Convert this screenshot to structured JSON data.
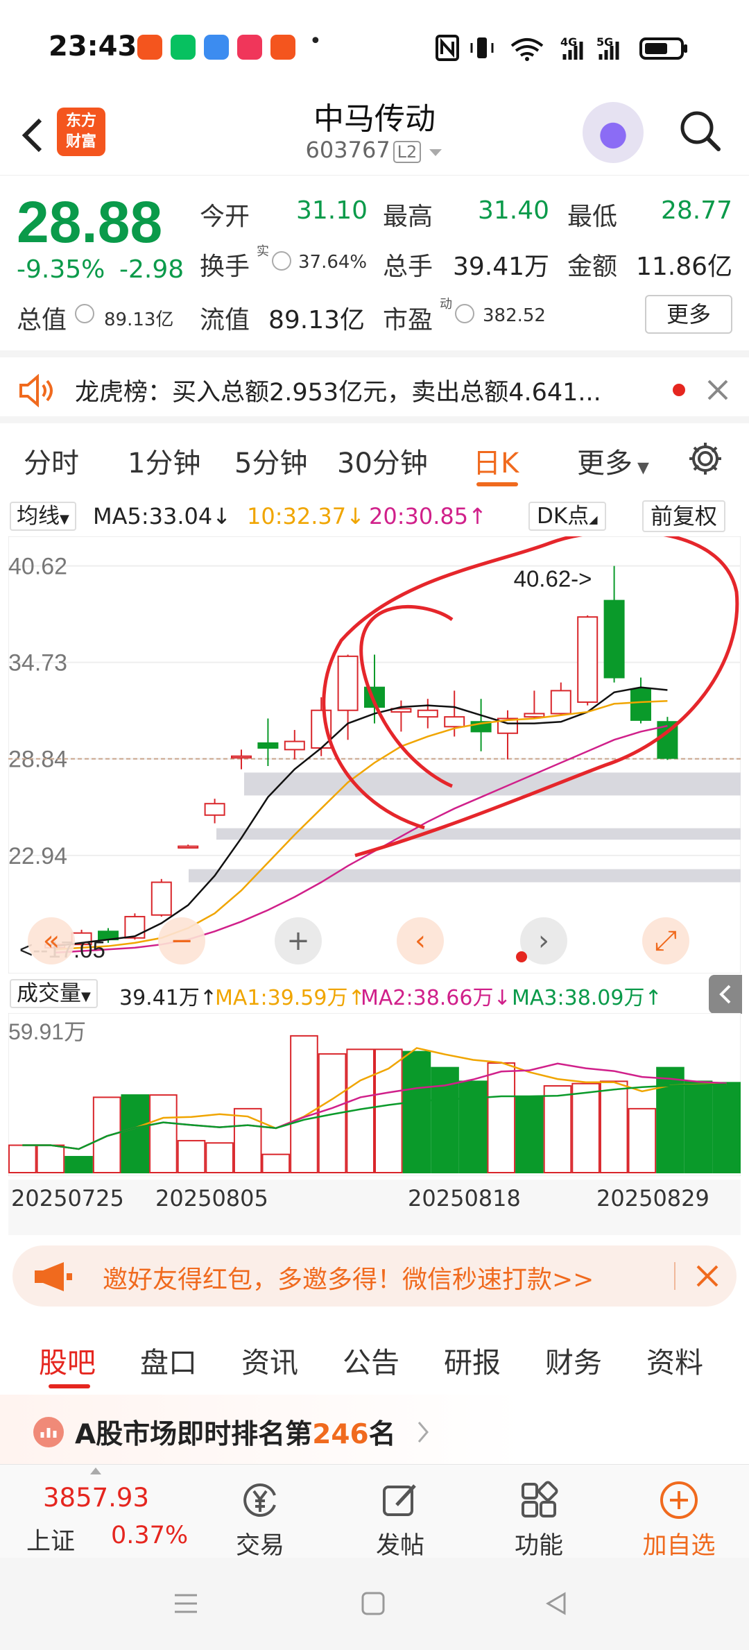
{
  "status_bar": {
    "time": "23:43",
    "dot": "•"
  },
  "header": {
    "back_icon": "chevron-left-icon",
    "logo_line1": "东方",
    "logo_line2": "财富",
    "title": "中马传动",
    "code": "603767",
    "level": "L2"
  },
  "quote": {
    "price": "28.88",
    "change_pct": "-9.35%",
    "change_abs": "-2.98",
    "open_label": "今开",
    "open": "31.10",
    "high_label": "最高",
    "high": "31.40",
    "low_label": "最低",
    "low": "28.77",
    "turnover_label": "换手",
    "turnover_sup": "实",
    "turnover": "37.64%",
    "volume_label": "总手",
    "volume": "39.41万",
    "amount_label": "金额",
    "amount": "11.86亿",
    "mktcap_label": "总值",
    "mktcap": "89.13亿",
    "float_label": "流值",
    "float": "89.13亿",
    "pe_label": "市盈",
    "pe_sup": "动",
    "pe": "382.52",
    "more": "更多"
  },
  "dragon_tiger": {
    "text": "龙虎榜：买入总额2.953亿元，卖出总额4.641..."
  },
  "chart_tabs": [
    "分时",
    "1分钟",
    "5分钟",
    "30分钟",
    "日K",
    "更多"
  ],
  "active_tab": "日K",
  "ma_bar": {
    "button": "均线",
    "ma5": "MA5:33.04↓",
    "ma10": "10:32.37↓",
    "ma20": "20:30.85↑",
    "dk": "DK点",
    "adjust": "前复权"
  },
  "volume_bar": {
    "button": "成交量",
    "vol": "39.41万↑",
    "ma1": "MA1:39.59万↑",
    "ma2": "MA2:38.66万↓",
    "ma3": "MA3:38.09万↑"
  },
  "chart_data": [
    {
      "type": "candlestick",
      "title": "",
      "y_ticks": [
        "40.62",
        "34.73",
        "28.84",
        "22.94"
      ],
      "ylim": [
        17.0,
        42.0
      ],
      "current_price_line": 28.84,
      "annotations": [
        "40.62->",
        "<--17.05"
      ],
      "candles": [
        {
          "o": 17.3,
          "c": 17.5,
          "h": 17.6,
          "l": 17.05,
          "color": "red"
        },
        {
          "o": 17.5,
          "c": 18.2,
          "h": 18.4,
          "l": 17.3,
          "color": "red"
        },
        {
          "o": 18.3,
          "c": 17.8,
          "h": 18.5,
          "l": 17.6,
          "color": "green"
        },
        {
          "o": 17.9,
          "c": 19.2,
          "h": 19.4,
          "l": 17.8,
          "color": "red"
        },
        {
          "o": 19.3,
          "c": 21.3,
          "h": 21.5,
          "l": 19.2,
          "color": "red"
        },
        {
          "o": 23.4,
          "c": 23.5,
          "h": 23.6,
          "l": 23.4,
          "color": "red"
        },
        {
          "o": 25.4,
          "c": 26.1,
          "h": 26.4,
          "l": 24.9,
          "color": "red"
        },
        {
          "o": 28.9,
          "c": 29.0,
          "h": 29.4,
          "l": 28.2,
          "color": "red"
        },
        {
          "o": 29.8,
          "c": 29.5,
          "h": 31.3,
          "l": 28.4,
          "color": "green"
        },
        {
          "o": 29.4,
          "c": 29.9,
          "h": 30.6,
          "l": 28.8,
          "color": "red"
        },
        {
          "o": 29.5,
          "c": 31.8,
          "h": 32.6,
          "l": 29.0,
          "color": "red"
        },
        {
          "o": 31.8,
          "c": 35.1,
          "h": 35.2,
          "l": 30.0,
          "color": "red"
        },
        {
          "o": 33.2,
          "c": 32.0,
          "h": 35.2,
          "l": 31.0,
          "color": "green"
        },
        {
          "o": 31.7,
          "c": 31.9,
          "h": 32.4,
          "l": 30.5,
          "color": "red"
        },
        {
          "o": 31.4,
          "c": 31.8,
          "h": 32.5,
          "l": 30.7,
          "color": "red"
        },
        {
          "o": 30.8,
          "c": 31.4,
          "h": 33.0,
          "l": 30.2,
          "color": "red"
        },
        {
          "o": 31.1,
          "c": 30.5,
          "h": 32.5,
          "l": 29.3,
          "color": "green"
        },
        {
          "o": 30.4,
          "c": 31.3,
          "h": 31.8,
          "l": 28.8,
          "color": "red"
        },
        {
          "o": 31.4,
          "c": 31.6,
          "h": 33.0,
          "l": 31.3,
          "color": "red"
        },
        {
          "o": 31.6,
          "c": 33.0,
          "h": 33.5,
          "l": 31.5,
          "color": "red"
        },
        {
          "o": 32.3,
          "c": 37.5,
          "h": 37.6,
          "l": 32.1,
          "color": "red"
        },
        {
          "o": 38.5,
          "c": 33.8,
          "h": 40.62,
          "l": 33.5,
          "color": "green"
        },
        {
          "o": 33.1,
          "c": 31.2,
          "h": 33.8,
          "l": 31.0,
          "color": "green"
        },
        {
          "o": 31.1,
          "c": 28.88,
          "h": 31.4,
          "l": 28.77,
          "color": "green"
        }
      ],
      "ma5": [
        17.4,
        17.6,
        17.8,
        18.0,
        18.8,
        19.9,
        21.7,
        24.0,
        26.5,
        28.2,
        29.5,
        31.0,
        31.6,
        32.0,
        32.1,
        32.0,
        31.5,
        31.0,
        31.0,
        31.1,
        31.7,
        32.9,
        33.2,
        33.04
      ],
      "ma10": [
        17.2,
        17.3,
        17.4,
        17.6,
        17.9,
        18.5,
        19.4,
        20.8,
        22.5,
        24.2,
        25.8,
        27.4,
        28.6,
        29.6,
        30.2,
        30.7,
        31.0,
        31.2,
        31.3,
        31.5,
        31.7,
        32.2,
        32.3,
        32.37
      ],
      "ma20": [
        17.0,
        17.1,
        17.2,
        17.3,
        17.5,
        17.8,
        18.3,
        18.9,
        19.6,
        20.4,
        21.3,
        22.3,
        23.2,
        24.1,
        25.0,
        25.8,
        26.5,
        27.2,
        27.9,
        28.6,
        29.3,
        30.0,
        30.5,
        30.85
      ]
    },
    {
      "type": "bar",
      "title": "",
      "y_tick": "59.91万",
      "x_ticks": [
        "20250725",
        "20250805",
        "20250818",
        "20250829"
      ],
      "values": [
        12,
        12,
        7,
        33,
        34,
        34,
        14,
        13,
        28,
        8,
        59.91,
        52,
        54,
        54,
        53,
        46,
        40,
        48,
        33,
        38,
        39,
        40,
        28,
        46,
        40,
        39.41
      ],
      "colors": [
        "r",
        "r",
        "g",
        "r",
        "g",
        "r",
        "r",
        "r",
        "r",
        "r",
        "r",
        "r",
        "r",
        "r",
        "g",
        "g",
        "g",
        "r",
        "g",
        "r",
        "r",
        "r",
        "r",
        "g",
        "g",
        "g"
      ]
    }
  ],
  "chart_controls": {
    "zoom_in": "+"
  },
  "invite": {
    "text": "邀好友得红包，多邀多得！微信秒速打款>>"
  },
  "sub_tabs": [
    "股吧",
    "盘口",
    "资讯",
    "公告",
    "研报",
    "财务",
    "资料"
  ],
  "rank": {
    "prefix": "A股市场即时排名第",
    "num": "246",
    "suffix": "名"
  },
  "bottom": {
    "index_value": "3857.93",
    "index_name": "上证",
    "index_pct": "0.37%",
    "trade": "交易",
    "post": "发帖",
    "func": "功能",
    "watch": "加自选"
  }
}
